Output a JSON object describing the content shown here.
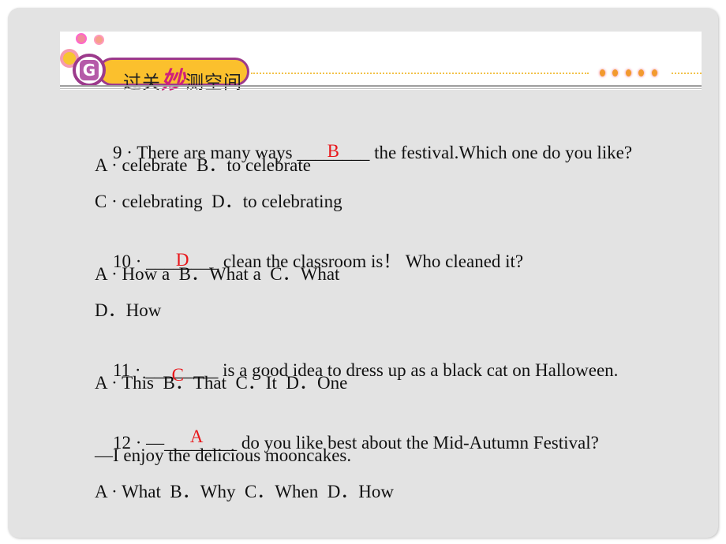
{
  "banner": {
    "badge_letter": "G",
    "title_part1": "过关",
    "title_highlight": "妙",
    "title_part2": "测空间"
  },
  "questions": [
    {
      "number": "9",
      "prefix": "9 · There are many ways ",
      "blank": "________",
      "answer": "B",
      "suffix": " the festival.Which one do you like?",
      "options_lines": [
        "A · celebrate  B．to celebrate",
        "C · celebrating  D．to celebrating"
      ]
    },
    {
      "number": "10",
      "prefix": "10 · ",
      "blank": "________",
      "answer": "D",
      "suffix": " clean the classroom is！ Who cleaned it?",
      "options_lines": [
        "A · How a  B．What a  C．What",
        "D．How"
      ]
    },
    {
      "number": "11",
      "prefix": "11 · ",
      "blank": "________",
      "answer": "C",
      "suffix": " is a good idea to dress up as a black cat on Halloween.",
      "options_lines": [
        "A · This  B．That  C．It  D．One"
      ]
    },
    {
      "number": "12",
      "prefix": "12 · —",
      "blank": "________",
      "answer": "A",
      "suffix": " do you like best about the Mid-Autumn Festival?",
      "response": "—I enjoy the delicious mooncakes.",
      "options_lines": [
        "A · What  B．Why  C．When  D．How"
      ]
    }
  ]
}
